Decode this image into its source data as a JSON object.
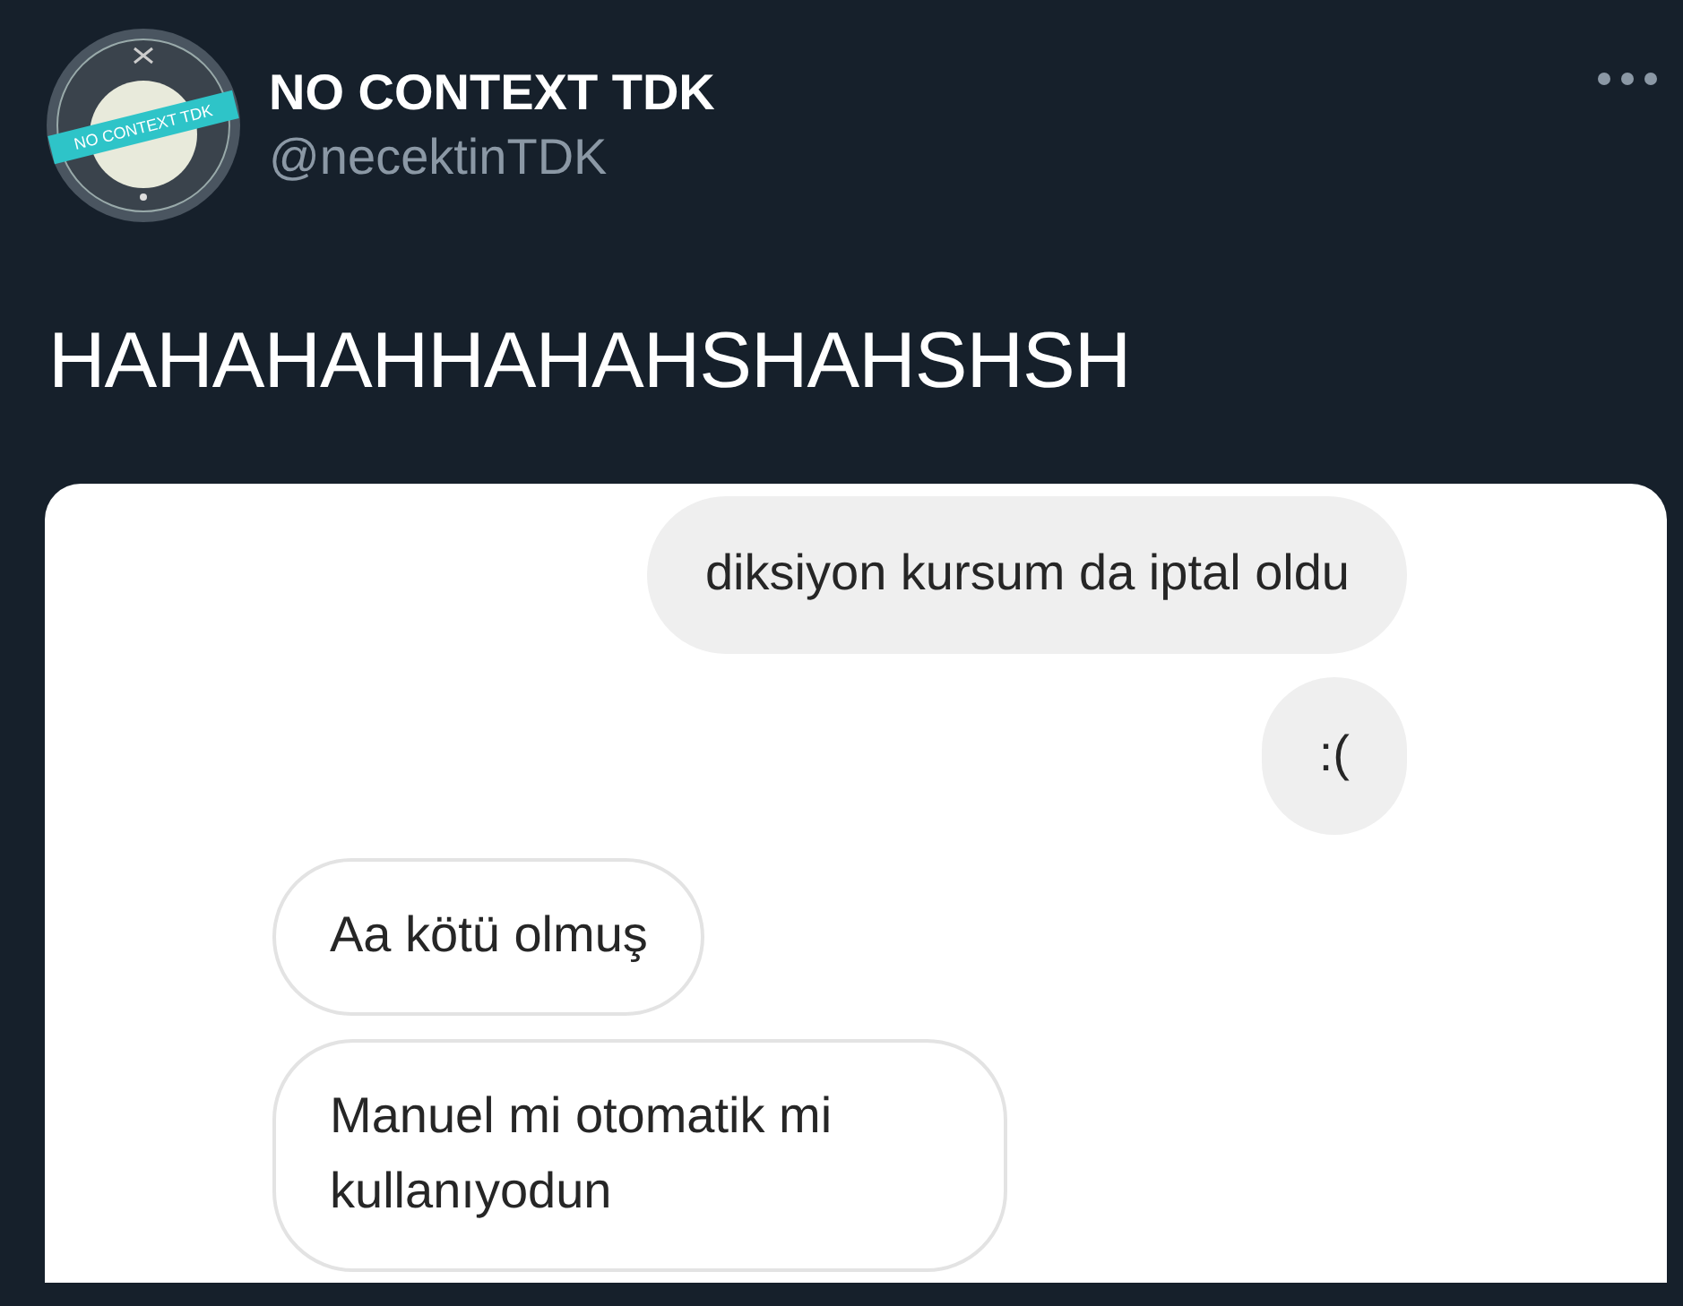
{
  "author": {
    "name": "NO CONTEXT TDK",
    "handle": "@necektinTDK",
    "avatar_banner": "NO CONTEXT TDK"
  },
  "tweet_text": "HAHAHAHHAHAHSHAHSHSH",
  "chat": [
    {
      "kind": "sent",
      "text": "diksiyon kursum da iptal oldu"
    },
    {
      "kind": "sent",
      "text": ":("
    },
    {
      "kind": "received",
      "text": "Aa kötü olmuş"
    },
    {
      "kind": "received",
      "text": "Manuel mi otomatik mi kullanıyodun"
    }
  ]
}
